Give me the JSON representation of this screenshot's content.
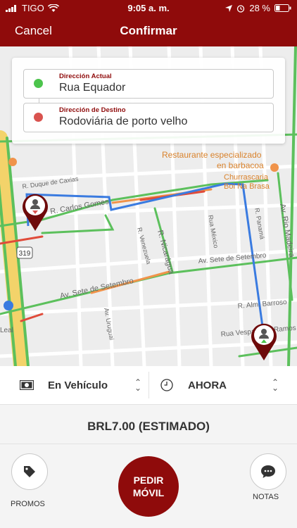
{
  "status_bar": {
    "carrier": "TIGO",
    "time": "9:05 a. m.",
    "battery": "28 %"
  },
  "nav": {
    "cancel_label": "Cancel",
    "title": "Confirmar"
  },
  "addresses": {
    "current_label": "Dirección Actual",
    "current_value": "Rua Equador",
    "destination_label": "Dirección de Destino",
    "destination_value": "Rodoviária de porto velho"
  },
  "map_labels": {
    "poi_restaurant_1": "Restaurante especializado",
    "poi_restaurant_2": "en barbacoa",
    "poi_churrascaria_1": "Churrascaria",
    "poi_churrascaria_2": "Boi Na Brasa",
    "street_duque": "R. Duque de Caxias",
    "street_carlos": "R. Carlos Gomes",
    "street_nicaragua": "R. Nicarágua",
    "street_venezuela": "R. Venezuela",
    "street_mexico": "Rua México",
    "street_panama": "R. Panamá",
    "street_rio_madeira": "Av. Rio Madeira",
    "street_sete_1": "Av. Sete de Setembro",
    "street_sete_2": "Av. Sete de Setembro",
    "street_uruguai": "Av. Uruguai",
    "street_alm": "R. Alm. Barroso",
    "street_vespaziano": "Rua Vespaziano Ramos",
    "highway": "319",
    "edge_leal": "Leal"
  },
  "trip": {
    "payment": "En Vehículo",
    "time_option": "AHORA",
    "price": "BRL7.00 (ESTIMADO)"
  },
  "actions": {
    "promos_label": "PROMOS",
    "notas_label": "NOTAS",
    "pedir_line1": "PEDIR",
    "pedir_line2": "MÓVIL"
  },
  "colors": {
    "brand": "#8f0b0b",
    "origin_dot": "#4cc44c",
    "destination_dot": "#d9534f",
    "route_blue": "#3a7be0"
  },
  "icons": {
    "signal": "signal-bars-icon",
    "wifi": "wifi-icon",
    "location_arrow": "location-arrow-icon",
    "alarm": "alarm-icon",
    "battery": "battery-icon",
    "payment": "cash-icon",
    "time": "clock-icon",
    "promos": "tag-icon",
    "notas": "chat-icon",
    "origin_pin": "person-pin-icon",
    "destination_pin": "person-pin-icon"
  }
}
